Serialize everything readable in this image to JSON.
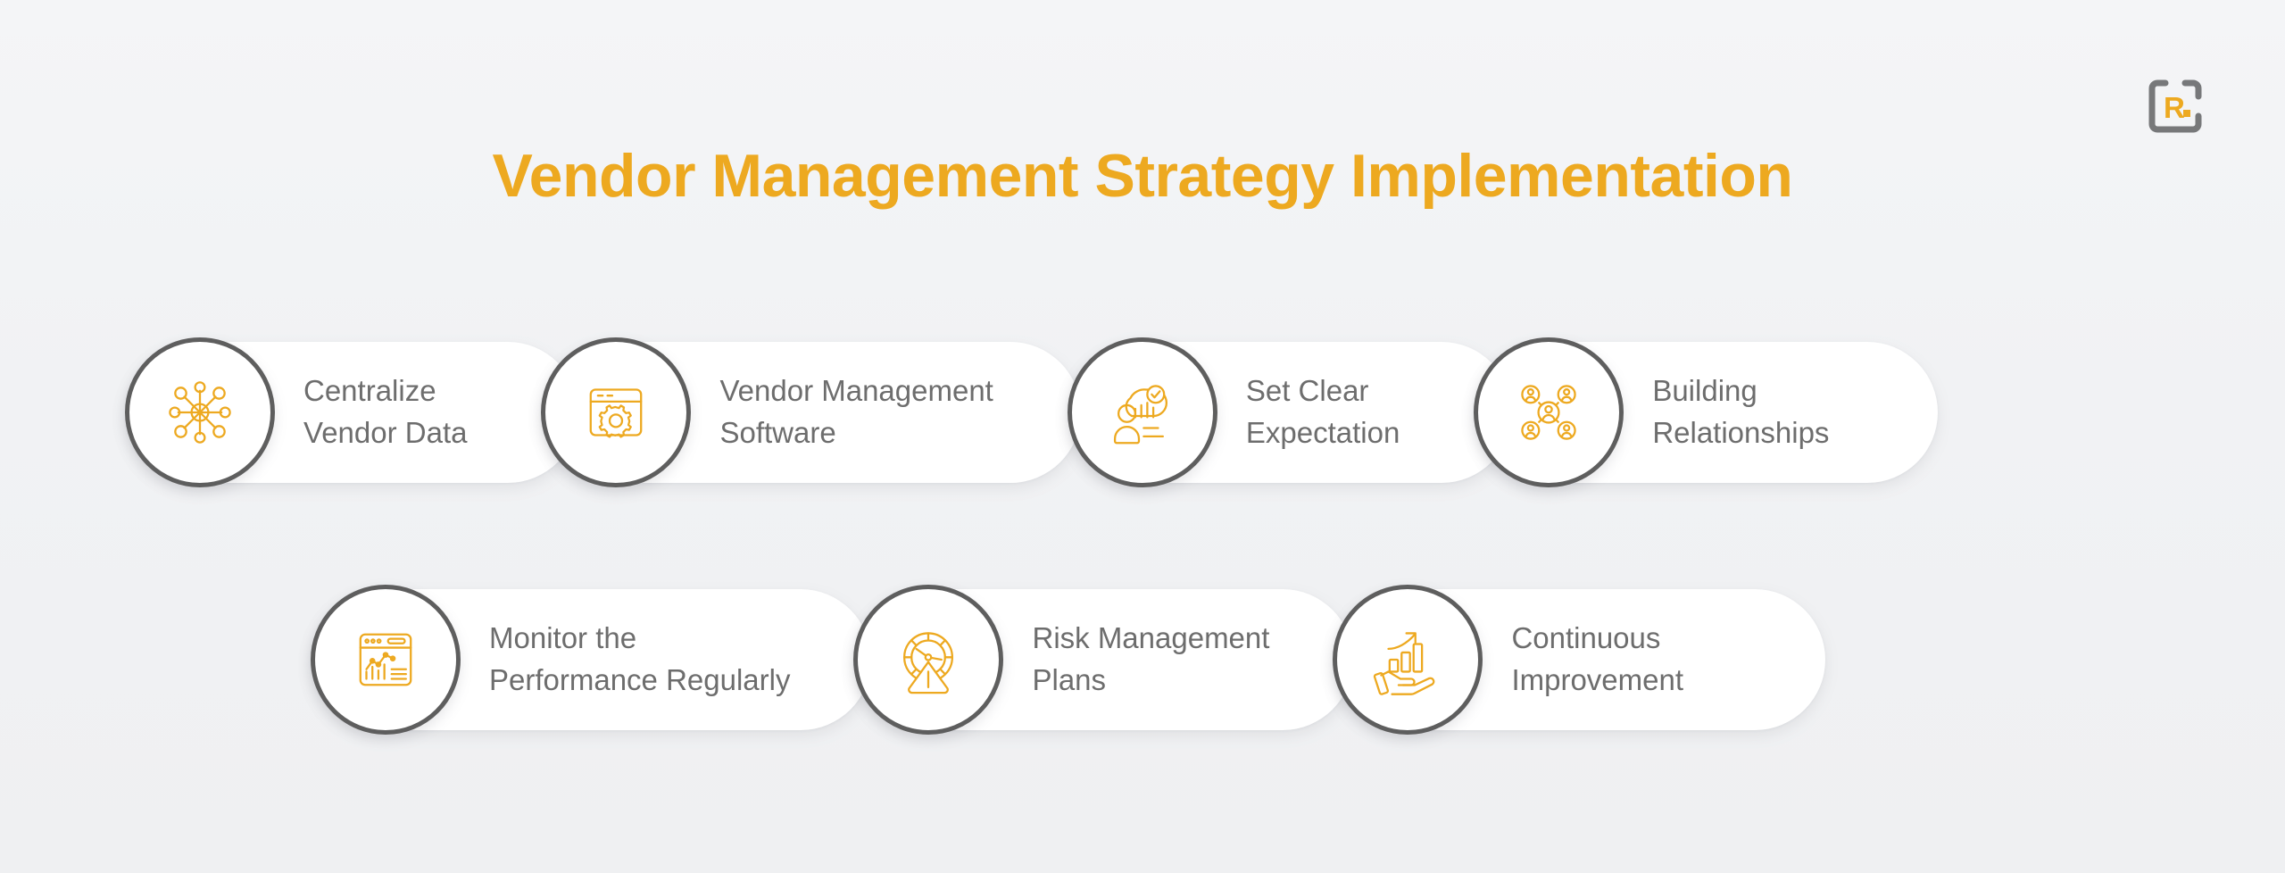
{
  "slide": {
    "title": "Vendor Management Strategy Implementation",
    "background_color": "#f2f3f5",
    "accent_color": "#eda920",
    "text_color": "#6d6d6d",
    "circle_border_color": "#5e5e5e"
  },
  "logo": {
    "name": "brand-logo",
    "letter": "R",
    "dot": ".",
    "frame_color": "#77787a",
    "letter_color": "#eda920"
  },
  "rows": [
    {
      "row_name": "row-1",
      "cards": [
        {
          "id": "c1",
          "icon": "network-hub-icon",
          "label": "Centralize\nVendor Data"
        },
        {
          "id": "c2",
          "icon": "browser-gear-icon",
          "label": "Vendor Management\nSoftware"
        },
        {
          "id": "c3",
          "icon": "person-chart-check-icon",
          "label": "Set Clear\nExpectation"
        },
        {
          "id": "c4",
          "icon": "people-network-icon",
          "label": "Building\nRelationships"
        }
      ]
    },
    {
      "row_name": "row-2",
      "cards": [
        {
          "id": "c5",
          "icon": "browser-analytics-icon",
          "label": "Monitor the\nPerformance Regularly"
        },
        {
          "id": "c6",
          "icon": "risk-gauge-warning-icon",
          "label": "Risk Management\nPlans"
        },
        {
          "id": "c7",
          "icon": "hand-growth-chart-icon",
          "label": "Continuous\nImprovement"
        }
      ]
    }
  ]
}
